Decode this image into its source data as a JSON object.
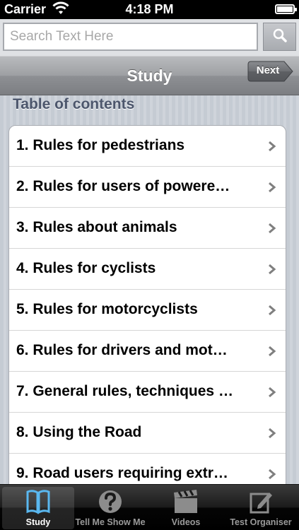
{
  "status_bar": {
    "carrier": "Carrier",
    "time": "4:18 PM",
    "wifi_icon": "wifi-icon",
    "battery_icon": "battery-icon"
  },
  "search": {
    "placeholder": "Search Text Here",
    "value": "",
    "icon": "search-icon"
  },
  "nav": {
    "title": "Study",
    "next_label": "Next"
  },
  "toc": {
    "header": "Table of contents",
    "items": [
      {
        "label": "1. Rules for pedestrians"
      },
      {
        "label": "2. Rules for users of powere…"
      },
      {
        "label": "3. Rules about animals"
      },
      {
        "label": "4. Rules for cyclists"
      },
      {
        "label": "5. Rules for motorcyclists"
      },
      {
        "label": "6. Rules for drivers and mot…"
      },
      {
        "label": "7. General rules, techniques …"
      },
      {
        "label": "8. Using the Road"
      },
      {
        "label": "9. Road users requiring extr…"
      }
    ]
  },
  "tab_bar": {
    "tabs": [
      {
        "label": "Study",
        "icon": "book-icon",
        "selected": true
      },
      {
        "label": "Tell Me Show Me",
        "icon": "question-icon",
        "selected": false
      },
      {
        "label": "Videos",
        "icon": "clapperboard-icon",
        "selected": false
      },
      {
        "label": "Test Organiser",
        "icon": "notepad-pencil-icon",
        "selected": false
      }
    ]
  },
  "colors": {
    "accent_selected_tab": "#5ab8f0",
    "section_header": "#4c566c"
  }
}
